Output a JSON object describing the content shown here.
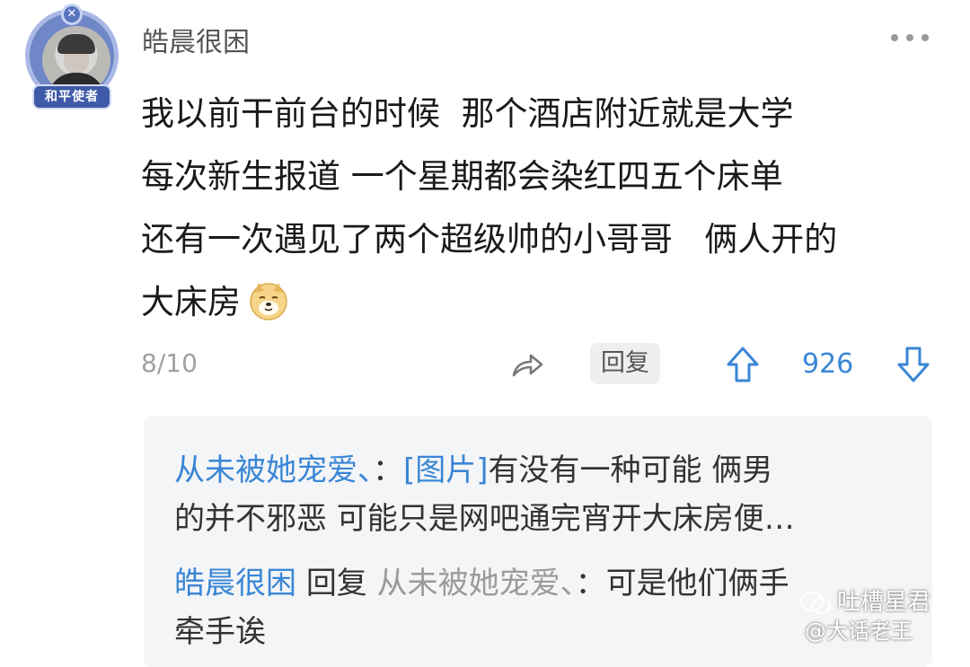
{
  "post": {
    "username": "皓晨很困",
    "badge_text": "和平使者",
    "content_lines": [
      "我以前干前台的时候  那个酒店附近就是大学",
      "每次新生报道 一个星期都会染红四五个床单",
      "还有一次遇见了两个超级帅的小哥哥   俩人开的",
      "大床房"
    ],
    "emoji": "doge-emoji",
    "date": "8/10",
    "reply_label": "回复",
    "vote_count": "926"
  },
  "replies": {
    "first": {
      "author": "从未被她宠爱、",
      "colon": "：",
      "tag": "[图片]",
      "text_line1": "有没有一种可能 俩男",
      "text_line2": "的并不邪恶 可能只是网吧通完宵开大床房便…"
    },
    "second": {
      "author": "皓晨很困",
      "reply_word": "回复",
      "target": "从未被她宠爱、",
      "colon": "：",
      "text_line1": "可是他们俩手",
      "text_line2": "牵手诶"
    }
  },
  "watermark": {
    "line1": "吐槽星君",
    "line2": "@大话老王"
  },
  "colors": {
    "accent_blue": "#3a86d6",
    "meta_gray": "#a0a0a0",
    "reply_bg": "#f4f5f7"
  }
}
